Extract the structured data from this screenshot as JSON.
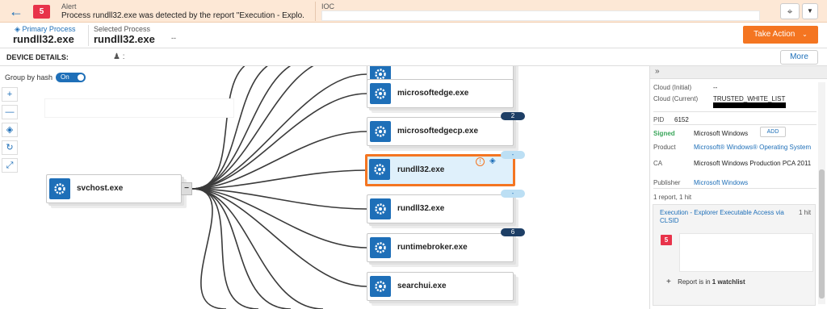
{
  "alert": {
    "label": "Alert",
    "severity": "5",
    "text": "Process rundll32.exe was detected by the report \"Execution - Explo...",
    "ioc_label": "IOC"
  },
  "process": {
    "primary_label": "Primary Process",
    "primary_name": "rundll32.exe",
    "selected_label": "Selected Process",
    "selected_name": "rundll32.exe",
    "selected_extra": "--",
    "take_action": "Take Action"
  },
  "device": {
    "label": "DEVICE DETAILS:",
    "user_value": ":",
    "more": "More"
  },
  "graph": {
    "group_by_hash_label": "Group by hash",
    "toggle_label": "On",
    "tools": [
      "+",
      "—",
      "◈",
      "↻",
      "⤢"
    ],
    "root": {
      "name": "svchost.exe",
      "collapse": "−"
    },
    "children": [
      {
        "name": "microsoftedge.exe",
        "badge": ""
      },
      {
        "name": "microsoftedgecp.exe",
        "badge": "2"
      },
      {
        "name": "rundll32.exe",
        "badge": "-"
      },
      {
        "name": "rundll32.exe",
        "badge": "-"
      },
      {
        "name": "runtimebroker.exe",
        "badge": "6"
      },
      {
        "name": "searchui.exe",
        "badge": ""
      }
    ]
  },
  "details": {
    "collapse_icon": "»",
    "cloud_initial_label": "Cloud (Initial)",
    "cloud_initial_value": "--",
    "cloud_current_label": "Cloud (Current)",
    "cloud_current_value": "TRUSTED_WHITE_LIST",
    "pid_label": "PID",
    "pid_value": "6152",
    "signed_label": "Signed",
    "signed_value": "Microsoft Windows",
    "add_label": "ADD",
    "product_label": "Product",
    "product_value": "Microsoft® Windows® Operating System",
    "ca_label": "CA",
    "ca_value": "Microsoft Windows Production PCA 2011",
    "publisher_label": "Publisher",
    "publisher_value": "Microsoft Windows",
    "reports_summary": "1 report, 1 hit",
    "report_link": "Execution - Explorer Executable Access via CLSID",
    "report_hits": "1 hit",
    "report_severity": "5",
    "watchlist_plus": "+",
    "watchlist_prefix": "Report is in ",
    "watchlist_count": "1 watchlist"
  },
  "colors": {
    "accent_blue": "#1e6fb8",
    "action_orange": "#f47521",
    "severity_red": "#e8334a",
    "alert_bg": "#fde8d6"
  }
}
